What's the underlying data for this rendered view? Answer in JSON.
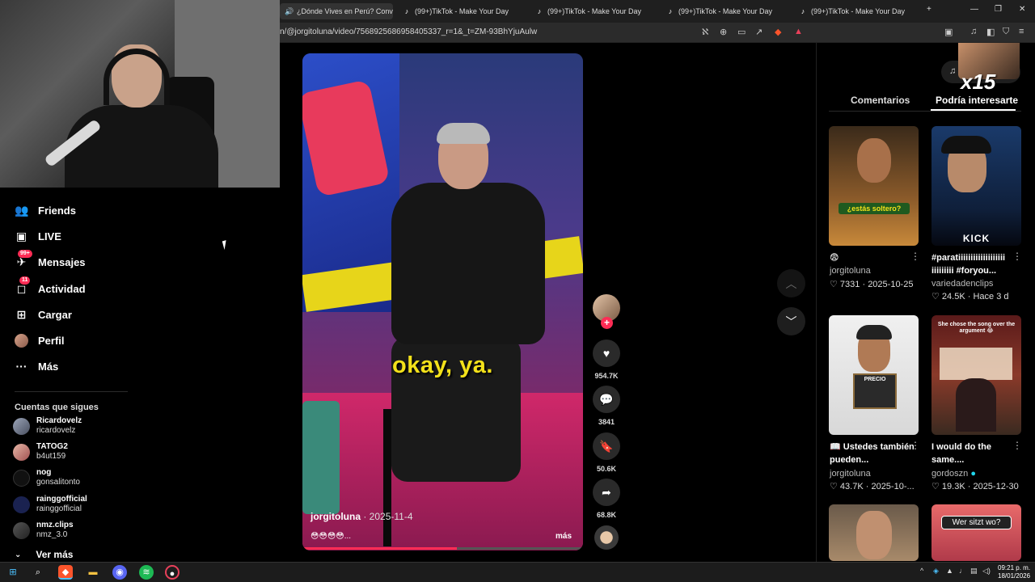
{
  "browser": {
    "tabs": [
      {
        "label": "¿Dónde Vives en Perú? Conv",
        "active": true
      },
      {
        "label": "(99+)TikTok - Make Your Day"
      },
      {
        "label": "(99+)TikTok - Make Your Day"
      },
      {
        "label": "(99+)TikTok - Make Your Day"
      },
      {
        "label": "(99+)TikTok - Make Your Day"
      }
    ],
    "url": "n/@jorgitoluna/video/7568925686958405337_r=1&_t=ZM-93BhYjuAulw"
  },
  "sidebar": {
    "nav": [
      {
        "label": "Friends",
        "icon": "friends-icon"
      },
      {
        "label": "LIVE",
        "icon": "live-icon"
      },
      {
        "label": "Mensajes",
        "icon": "messages-icon",
        "badge": "99+"
      },
      {
        "label": "Actividad",
        "icon": "activity-icon",
        "badge": "11"
      },
      {
        "label": "Cargar",
        "icon": "upload-icon"
      },
      {
        "label": "Perfil",
        "icon": "profile-avatar"
      },
      {
        "label": "Más",
        "icon": "more-icon"
      }
    ],
    "following_title": "Cuentas que sigues",
    "following": [
      {
        "name": "Ricardovelz",
        "user": "ricardovelz"
      },
      {
        "name": "TATOG2",
        "user": "b4ut159"
      },
      {
        "name": "nog",
        "user": "gonsalitonto"
      },
      {
        "name": "rainggofficial",
        "user": "rainggofficial"
      },
      {
        "name": "nmz.clips",
        "user": "nmz_3.0"
      }
    ],
    "see_more": "Ver más"
  },
  "video": {
    "caption": "okay, ya.",
    "author": "jorgitoluna",
    "date": "· 2025-11-4",
    "description": "😳😳😳😳...",
    "more": "más",
    "progress": 0.55
  },
  "actions": {
    "likes": "954.7K",
    "comments": "3841",
    "saves": "50.6K",
    "shares": "68.8K"
  },
  "right_panel": {
    "overlay_multiplier": "x15",
    "tabs": [
      "Comentarios",
      "Podría interesarte"
    ],
    "active_tab": 1,
    "cards": [
      {
        "title": "😨",
        "user": "jorgitoluna",
        "likes": "7331",
        "date": "2025-10-25",
        "overlay": "¿estás soltero?"
      },
      {
        "title": "#paratiiiiiiiiiiiiiiiiiii iiiiiiiii #foryou...",
        "user": "variedadenclips",
        "likes": "24.5K",
        "date": "Hace 3 d",
        "overlay": "KICK"
      },
      {
        "title": "📖 Ustedes también pueden...",
        "user": "jorgitoluna",
        "likes": "43.7K",
        "date": "2025-10-...",
        "overlay": "PRECIO"
      },
      {
        "title": "I would do the same....",
        "user": "gordoszn",
        "likes": "19.3K",
        "date": "2025-12-30",
        "overlay": "She chose the song over the argument 😂"
      },
      {
        "title": "",
        "user": "",
        "likes": "",
        "date": "",
        "overlay": ""
      },
      {
        "title": "",
        "user": "",
        "likes": "",
        "date": "",
        "overlay": "Wer sitzt wo?"
      }
    ]
  },
  "taskbar": {
    "time": "09:21 p. m.",
    "date": "18/01/2026"
  },
  "colors": {
    "accent": "#fe2c55",
    "caption": "#f3e11a"
  }
}
